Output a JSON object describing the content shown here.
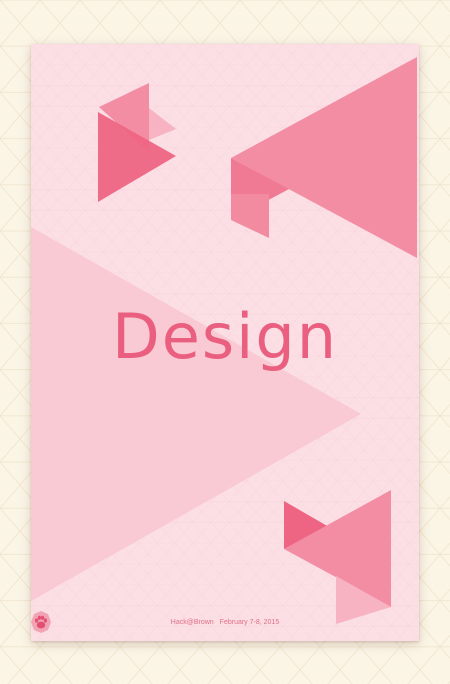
{
  "poster": {
    "title": "Design",
    "footer": {
      "organizer": "Hack@Brown",
      "dates": "February 7-8, 2015",
      "logo_icon": "paw-logo-icon"
    }
  },
  "colors": {
    "background": "#fbf5e6",
    "poster": "#fbdfe5",
    "accent": "#ea5f7f",
    "triangle_dark": "#ef6d8a",
    "triangle_mid": "#f38da3",
    "triangle_light": "#f7b3c2"
  }
}
